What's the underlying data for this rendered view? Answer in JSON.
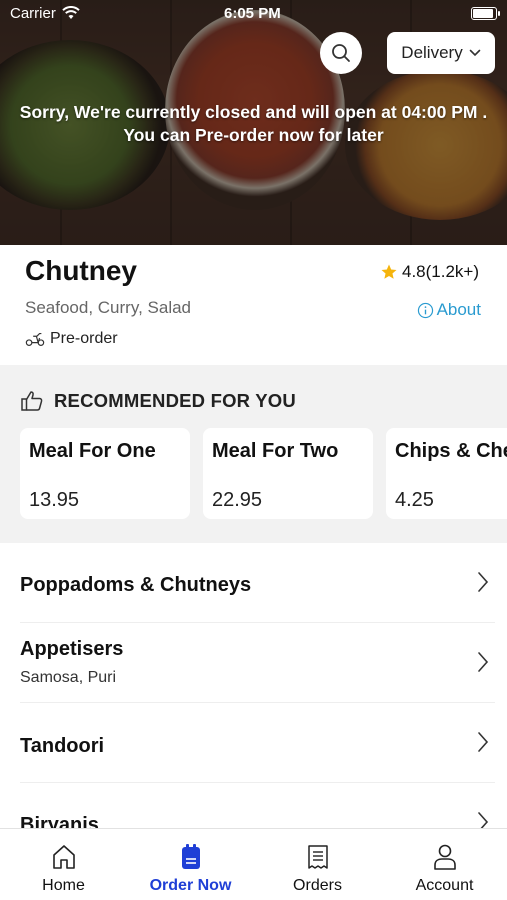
{
  "status_bar": {
    "carrier": "Carrier",
    "time": "6:05 PM"
  },
  "header": {
    "order_mode": "Delivery",
    "closed_message_line1": "Sorry, We're currently closed and will open at 04:00 PM .",
    "closed_message_line2": "You can Pre-order now for later"
  },
  "restaurant": {
    "name": "Chutney",
    "rating": "4.8(1.2k+)",
    "cuisines": "Seafood, Curry, Salad",
    "about_label": "About",
    "preorder_label": "Pre-order"
  },
  "recommended": {
    "heading": "RECOMMENDED FOR YOU",
    "items": [
      {
        "title": "Meal For One",
        "price": "13.95"
      },
      {
        "title": "Meal For Two",
        "price": "22.95"
      },
      {
        "title": "Chips & Cheese",
        "price": "4.25"
      }
    ]
  },
  "categories": [
    {
      "name": "Poppadoms & Chutneys",
      "subtitle": ""
    },
    {
      "name": "Appetisers",
      "subtitle": "Samosa, Puri"
    },
    {
      "name": "Tandoori",
      "subtitle": ""
    },
    {
      "name": "Biryanis",
      "subtitle": ""
    }
  ],
  "tabs": [
    {
      "label": "Home",
      "icon": "home-icon"
    },
    {
      "label": "Order Now",
      "icon": "order-icon"
    },
    {
      "label": "Orders",
      "icon": "receipt-icon"
    },
    {
      "label": "Account",
      "icon": "person-icon"
    }
  ],
  "colors": {
    "accent": "#1f3fd6",
    "link": "#2a9bd0",
    "star": "#f5b40c"
  }
}
